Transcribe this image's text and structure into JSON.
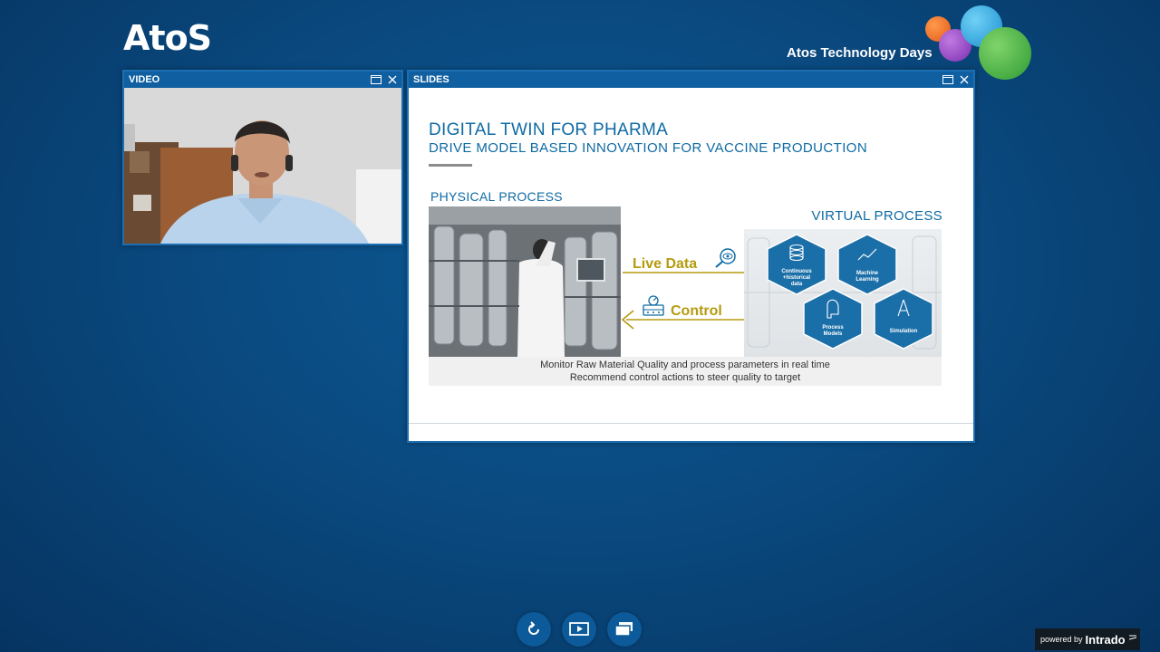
{
  "brand": {
    "logo": "AtoS",
    "event_title": "Atos Technology Days"
  },
  "video_panel": {
    "title": "VIDEO"
  },
  "slides_panel": {
    "title": "SLIDES",
    "slide": {
      "title": "DIGITAL TWIN FOR PHARMA",
      "subtitle": "DRIVE MODEL BASED INNOVATION FOR VACCINE PRODUCTION",
      "physical_label": "PHYSICAL PROCESS",
      "virtual_label": "VIRTUAL PROCESS",
      "live_data_label": "Live Data",
      "control_label": "Control",
      "hexagons": {
        "data": [
          "Continuous",
          "+historical",
          "data"
        ],
        "ml": [
          "Machine",
          "Learning"
        ],
        "models": [
          "Process",
          "Models"
        ],
        "sim": [
          "Simulation"
        ]
      },
      "caption_line1": "Monitor Raw Material Quality and process parameters in real time",
      "caption_line2": "Recommend control actions to steer quality to target"
    }
  },
  "footer": {
    "powered_by": "powered by",
    "brand": "Intrado"
  },
  "colors": {
    "accent": "#0e6aa3",
    "arrow": "#b59b10",
    "panel_header": "#0f5fa1"
  },
  "icons": {
    "toolbar": [
      "refresh-icon",
      "slides-icon",
      "screens-icon"
    ],
    "panel": [
      "maximize-icon",
      "close-icon"
    ]
  }
}
